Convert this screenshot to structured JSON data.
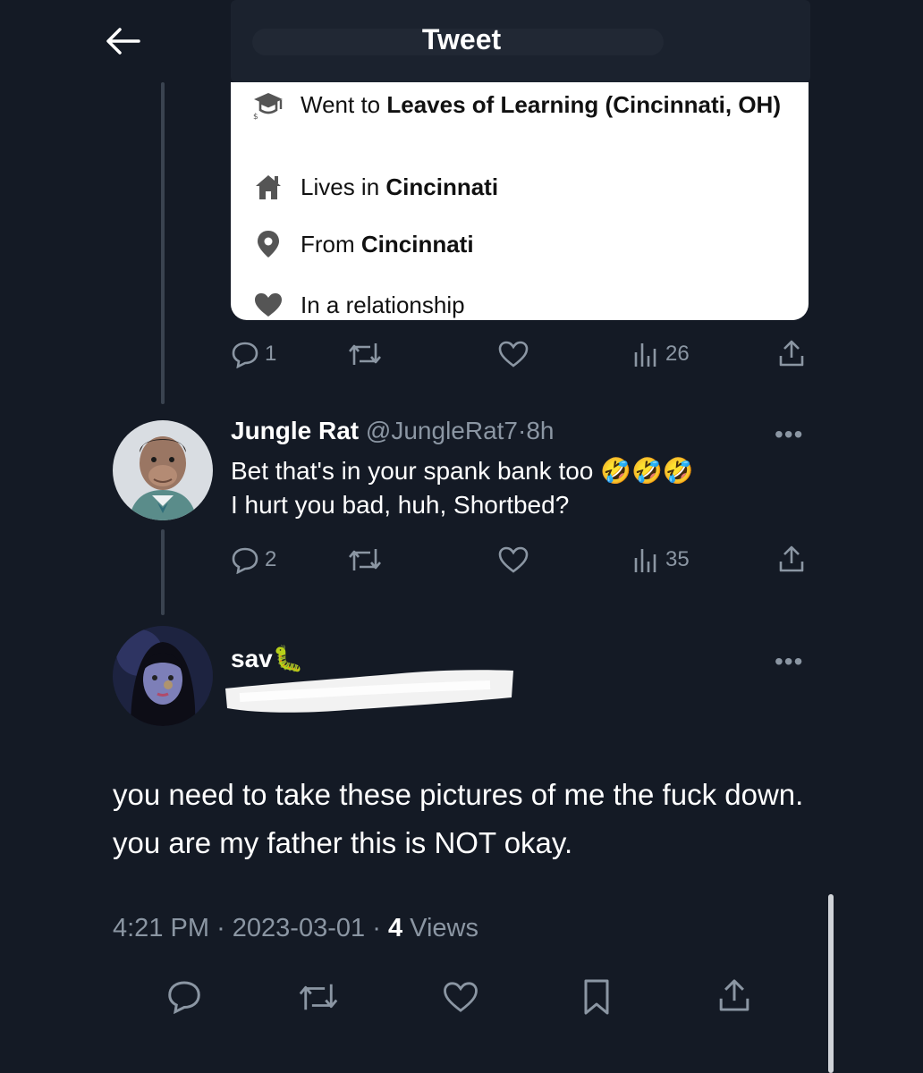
{
  "header": {
    "title": "Tweet"
  },
  "card": {
    "rows": [
      {
        "prefix": "Went to ",
        "bold": "Leaves of Learning (Cincinnati, OH)",
        "icon": "graduation-cap-icon"
      },
      {
        "prefix": "Lives in ",
        "bold": "Cincinnati",
        "icon": "house-icon"
      },
      {
        "prefix": "From ",
        "bold": "Cincinnati",
        "icon": "location-pin-icon"
      },
      {
        "prefix": "In a relationship",
        "bold": "",
        "icon": "heart-icon"
      }
    ]
  },
  "parent_actions": {
    "replies": "1",
    "views": "26"
  },
  "reply": {
    "name": "Jungle Rat",
    "handle": "@JungleRat7",
    "time": "8h",
    "line1": "Bet that's in your spank bank too",
    "emoji": "🤣🤣🤣",
    "line2": "I hurt you bad, huh, Shortbed?",
    "replies": "2",
    "views": "35"
  },
  "main": {
    "name": "sav",
    "name_emoji": "🐛",
    "text": "you need to take these pictures of me the fuck down. you are my father this is NOT okay.",
    "time": "4:21 PM",
    "date": "2023-03-01",
    "views_count": "4",
    "views_label": "Views"
  },
  "more_symbol": "•••"
}
